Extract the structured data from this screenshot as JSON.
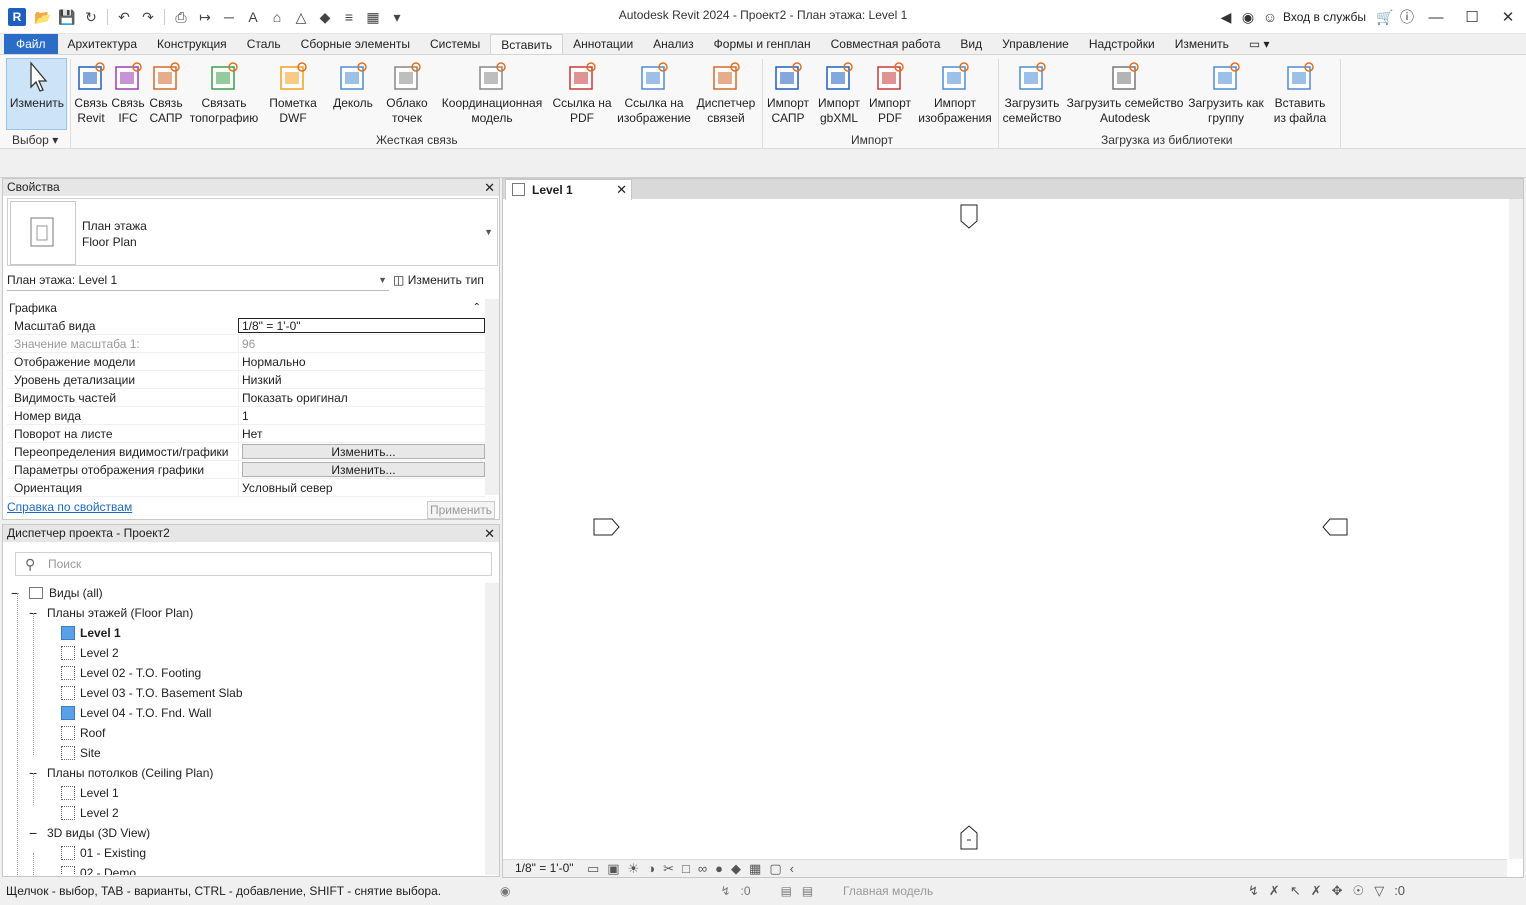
{
  "app": {
    "logo": "R",
    "title": "Autodesk Revit 2024 - Проект2 - План этажа: Level 1",
    "sign_in": "Вход в службы",
    "qat_icons": [
      "open-icon",
      "save-icon",
      "sync-icon",
      "undo-icon",
      "redo-icon",
      "print-icon",
      "measure-icon",
      "dimension-icon",
      "text-icon",
      "home-icon",
      "3d-view-icon",
      "section-icon",
      "thin-lines-icon",
      "close-hidden-icon",
      "switch-windows-icon"
    ]
  },
  "tabs": [
    "Файл",
    "Архитектура",
    "Конструкция",
    "Сталь",
    "Сборные элементы",
    "Системы",
    "Вставить",
    "Аннотации",
    "Анализ",
    "Формы и генплан",
    "Совместная работа",
    "Вид",
    "Управление",
    "Надстройки",
    "Изменить"
  ],
  "active_tab": "Вставить",
  "ribbon": {
    "modify": [
      "Изменить",
      ""
    ],
    "select_panel": "Выбор",
    "link_buttons": [
      {
        "l1": "Связь",
        "l2": "Revit"
      },
      {
        "l1": "Связь",
        "l2": "IFC"
      },
      {
        "l1": "Связь",
        "l2": "САПР"
      },
      {
        "l1": "Связать",
        "l2": "топографию"
      },
      {
        "l1": "Пометка",
        "l2": "DWF"
      },
      {
        "l1": "Деколь",
        "l2": ""
      },
      {
        "l1": "Облако",
        "l2": "точек"
      },
      {
        "l1": "Координационная",
        "l2": "модель"
      },
      {
        "l1": "Ссылка на",
        "l2": "PDF"
      },
      {
        "l1": "Ссылка на",
        "l2": "изображение"
      },
      {
        "l1": "Диспетчер",
        "l2": "связей"
      }
    ],
    "link_panel": "Жесткая связь",
    "import_buttons": [
      {
        "l1": "Импорт",
        "l2": "САПР"
      },
      {
        "l1": "Импорт",
        "l2": "gbXML"
      },
      {
        "l1": "Импорт",
        "l2": "PDF"
      },
      {
        "l1": "Импорт",
        "l2": "изображения"
      }
    ],
    "import_panel": "Импорт",
    "load_buttons": [
      {
        "l1": "Загрузить",
        "l2": "семейство"
      },
      {
        "l1": "Загрузить семейство",
        "l2": "Autodesk"
      },
      {
        "l1": "Загрузить как",
        "l2": "группу"
      },
      {
        "l1": "Вставить",
        "l2": "из файла"
      }
    ],
    "load_panel": "Загрузка из библиотеки"
  },
  "properties": {
    "title": "Свойства",
    "type_line1": "План этажа",
    "type_line2": "Floor Plan",
    "instance": "План этажа: Level 1",
    "edit_type": "Изменить тип",
    "group": "Графика",
    "rows": [
      {
        "k": "Масштаб вида",
        "v": "1/8\" = 1'-0\""
      },
      {
        "k": "Значение масштаба    1:",
        "v": "96"
      },
      {
        "k": "Отображение модели",
        "v": "Нормально"
      },
      {
        "k": "Уровень детализации",
        "v": "Низкий"
      },
      {
        "k": "Видимость частей",
        "v": "Показать оригинал"
      },
      {
        "k": "Номер вида",
        "v": "1"
      },
      {
        "k": "Поворот на листе",
        "v": "Нет"
      },
      {
        "k": "Переопределения видимости/графики",
        "v": "Изменить..."
      },
      {
        "k": "Параметры отображения графики",
        "v": "Изменить..."
      },
      {
        "k": "Ориентация",
        "v": "Условный север"
      }
    ],
    "help": "Справка по свойствам",
    "apply": "Применить"
  },
  "browser": {
    "title": "Диспетчер проекта - Проект2",
    "search_placeholder": "Поиск",
    "root": "Виды (all)",
    "floor_plans": "Планы этажей (Floor Plan)",
    "floor_items": [
      "Level 1",
      "Level 2",
      "Level 02 - T.O. Footing",
      "Level 03 - T.O. Basement Slab",
      "Level 04 - T.O. Fnd. Wall",
      "Roof",
      "Site"
    ],
    "ceiling_plans": "Планы потолков (Ceiling Plan)",
    "ceiling_items": [
      "Level 1",
      "Level 2"
    ],
    "views3d": "3D виды (3D View)",
    "items3d": [
      "01 - Existing",
      "02 - Demo"
    ]
  },
  "view": {
    "tab": "Level 1",
    "scale": "1/8\" = 1'-0\""
  },
  "status": {
    "message": "Щелчок - выбор, TAB - варианты, CTRL - добавление, SHIFT - снятие выбора.",
    "worksets": ":0",
    "model": "Главная модель",
    "filter": ":0"
  }
}
